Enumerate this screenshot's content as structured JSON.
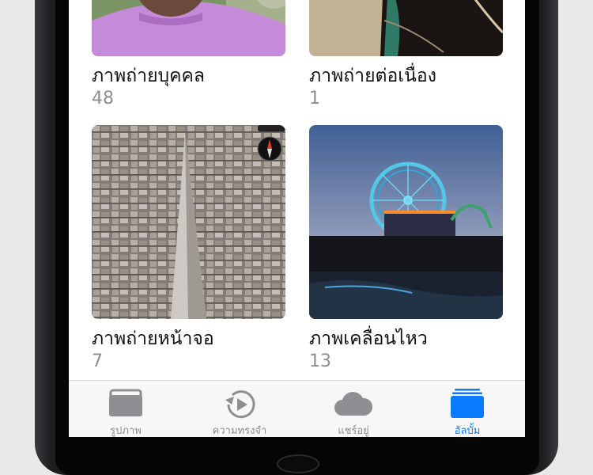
{
  "albums": [
    {
      "title": "ภาพถ่ายบุคคล",
      "count": "48"
    },
    {
      "title": "ภาพถ่ายต่อเนื่อง",
      "count": "1"
    },
    {
      "title": "ภาพถ่ายหน้าจอ",
      "count": "7"
    },
    {
      "title": "ภาพเคลื่อนไหว",
      "count": "13"
    }
  ],
  "tabbar": {
    "tabs": [
      {
        "label": "รูปภาพ",
        "icon": "photos-icon",
        "active": false
      },
      {
        "label": "ความทรงจำ",
        "icon": "memories-icon",
        "active": false
      },
      {
        "label": "แชร์อยู่",
        "icon": "cloud-icon",
        "active": false
      },
      {
        "label": "อัลบั้ม",
        "icon": "albums-icon",
        "active": true
      }
    ]
  },
  "colors": {
    "accent": "#0a7aff",
    "inactive": "#8e8e93",
    "tabbar_bg": "#f7f7f7"
  }
}
